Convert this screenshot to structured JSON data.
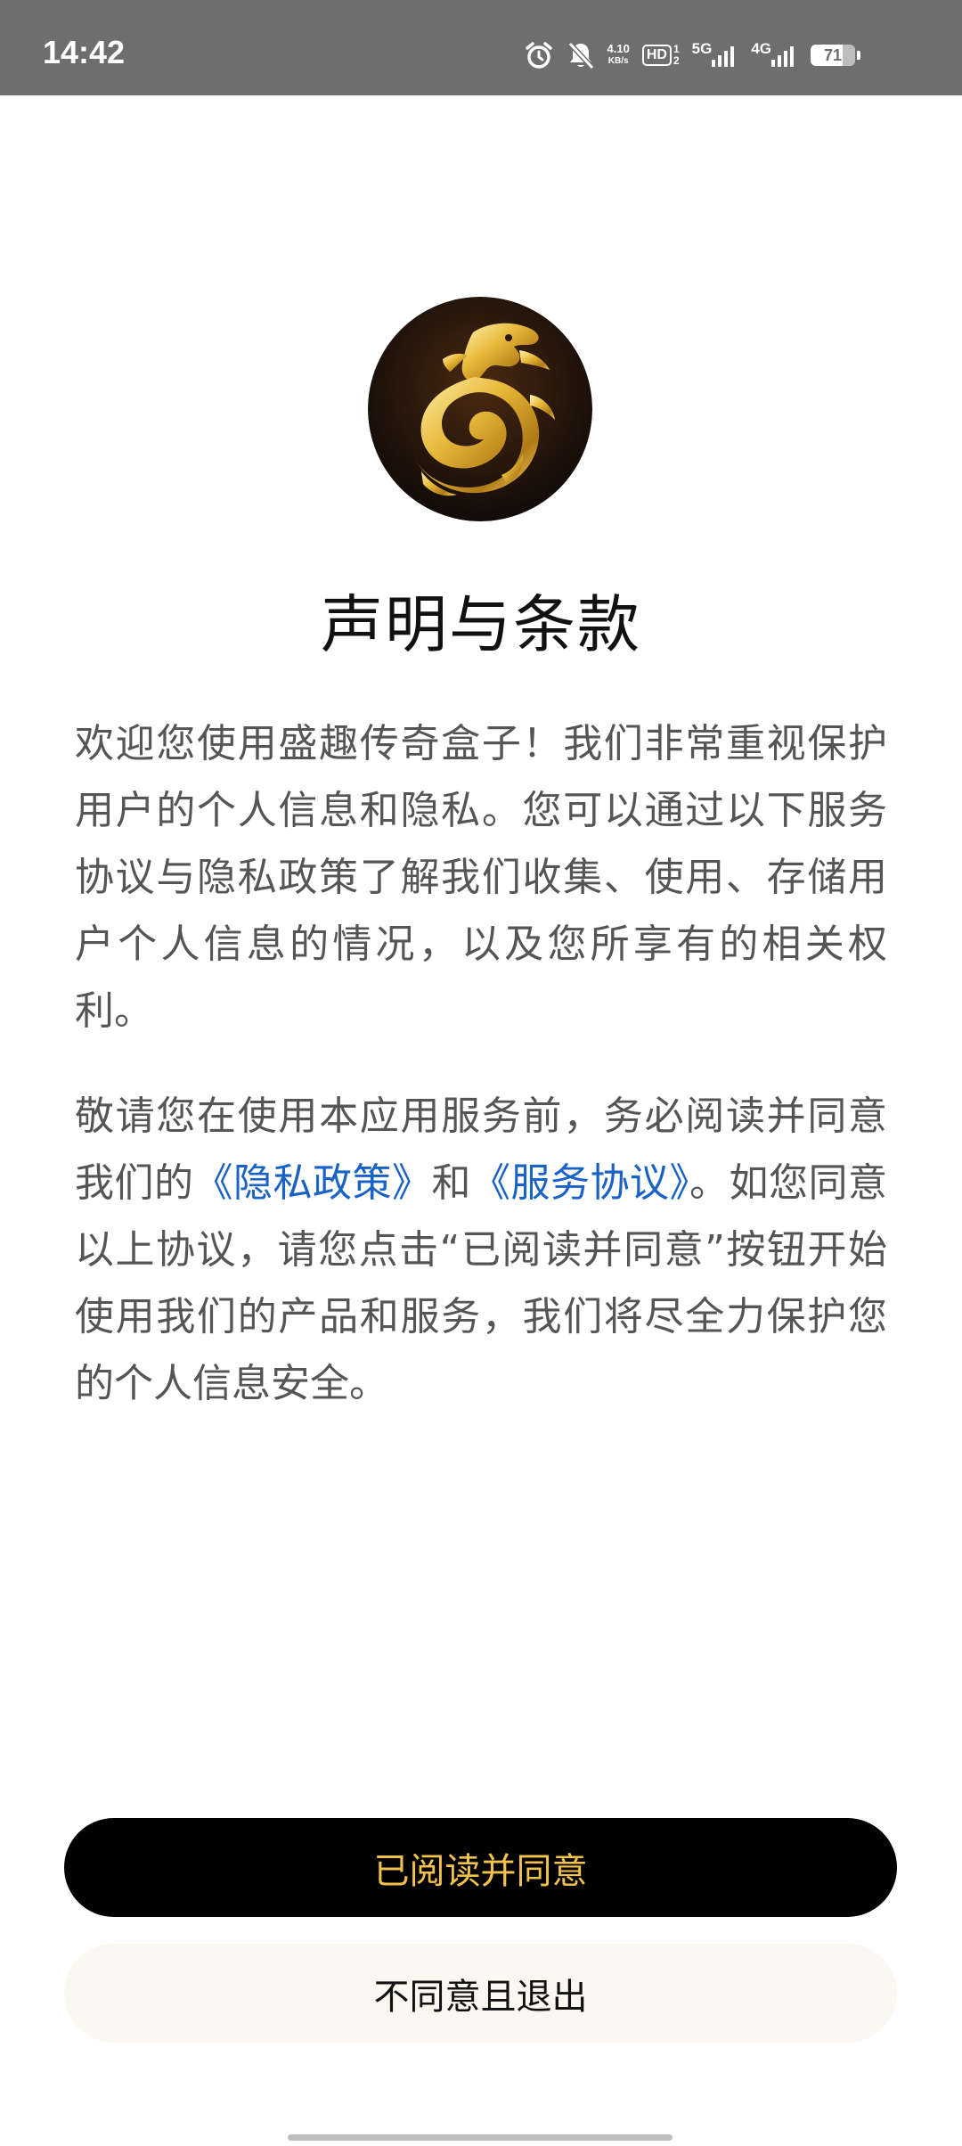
{
  "status_bar": {
    "time": "14:42",
    "net_speed_value": "4.10",
    "net_speed_unit": "KB/s",
    "hd_label": "HD",
    "hd_sub_top": "1",
    "hd_sub_bottom": "2",
    "network_1": "5G",
    "network_2": "4G",
    "battery_level": "71",
    "icons": [
      "alarm-icon",
      "bell-off-icon",
      "signal-icon",
      "battery-icon"
    ]
  },
  "logo": {
    "icon": "golden-dragon-logo"
  },
  "title": "声明与条款",
  "paragraph_1": "欢迎您使用盛趣传奇盒子！我们非常重视保护用户的个人信息和隐私。您可以通过以下服务协议与隐私政策了解我们收集、使用、存储用户个人信息的情况，以及您所享有的相关权利。",
  "paragraph_2": {
    "before": "敬请您在使用本应用服务前，务必阅读并同意我们的",
    "privacy_link": "《隐私政策》",
    "middle": "和",
    "service_link": "《服务协议》",
    "after": "。如您同意以上协议，请您点击“已阅读并同意”按钮开始使用我们的产品和服务，我们将尽全力保护您的个人信息安全。"
  },
  "buttons": {
    "agree": "已阅读并同意",
    "decline": "不同意且退出"
  },
  "colors": {
    "status_bar_bg": "#6e6e6e",
    "link": "#1a62c6",
    "agree_bg": "#000000",
    "agree_text": "#f2c24a",
    "decline_bg": "#fbf8f2"
  }
}
